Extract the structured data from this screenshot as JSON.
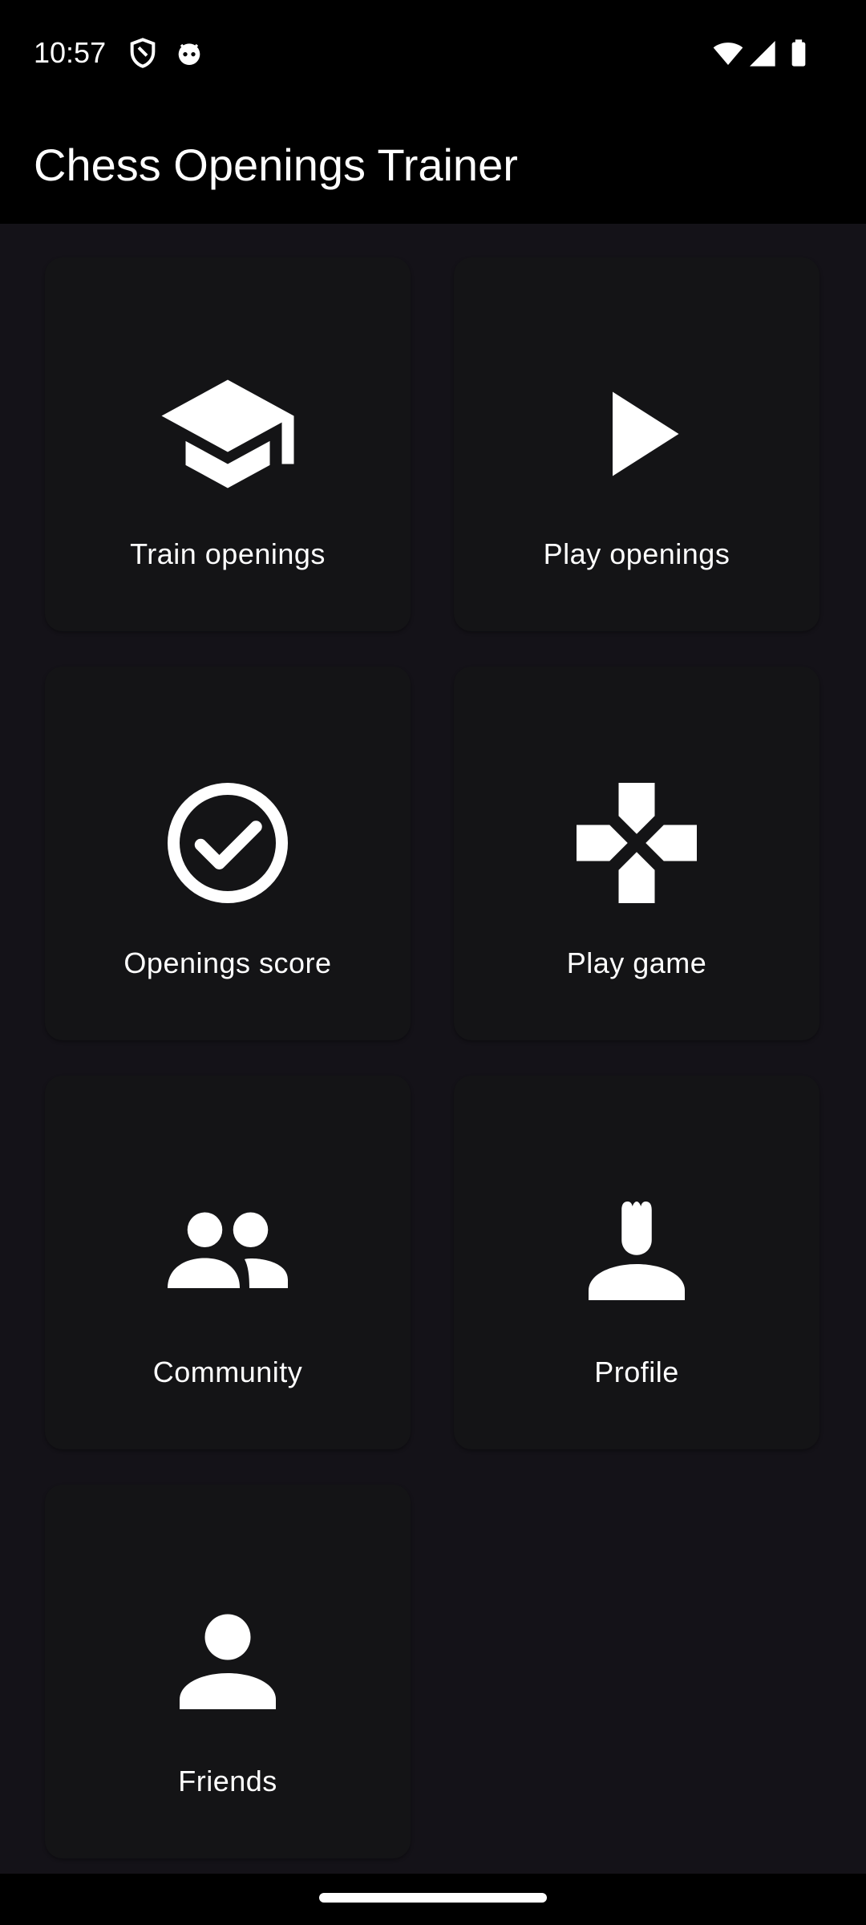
{
  "status_bar": {
    "time": "10:57",
    "icons": [
      "shield-icon",
      "android-face-icon",
      "wifi-icon",
      "signal-icon",
      "battery-icon"
    ]
  },
  "app_bar": {
    "title": "Chess Openings Trainer"
  },
  "tiles": [
    {
      "label": "Train openings",
      "icon": "graduation-cap-icon"
    },
    {
      "label": "Play openings",
      "icon": "play-icon"
    },
    {
      "label": "Openings score",
      "icon": "check-circle-icon"
    },
    {
      "label": "Play game",
      "icon": "gamepad-icon"
    },
    {
      "label": "Community",
      "icon": "people-icon"
    },
    {
      "label": "Profile",
      "icon": "chess-rook-person-icon"
    },
    {
      "label": "Friends",
      "icon": "person-icon"
    }
  ],
  "colors": {
    "background": "#141218",
    "tile": "#141416",
    "bars": "#000000",
    "foreground": "#ffffff"
  }
}
